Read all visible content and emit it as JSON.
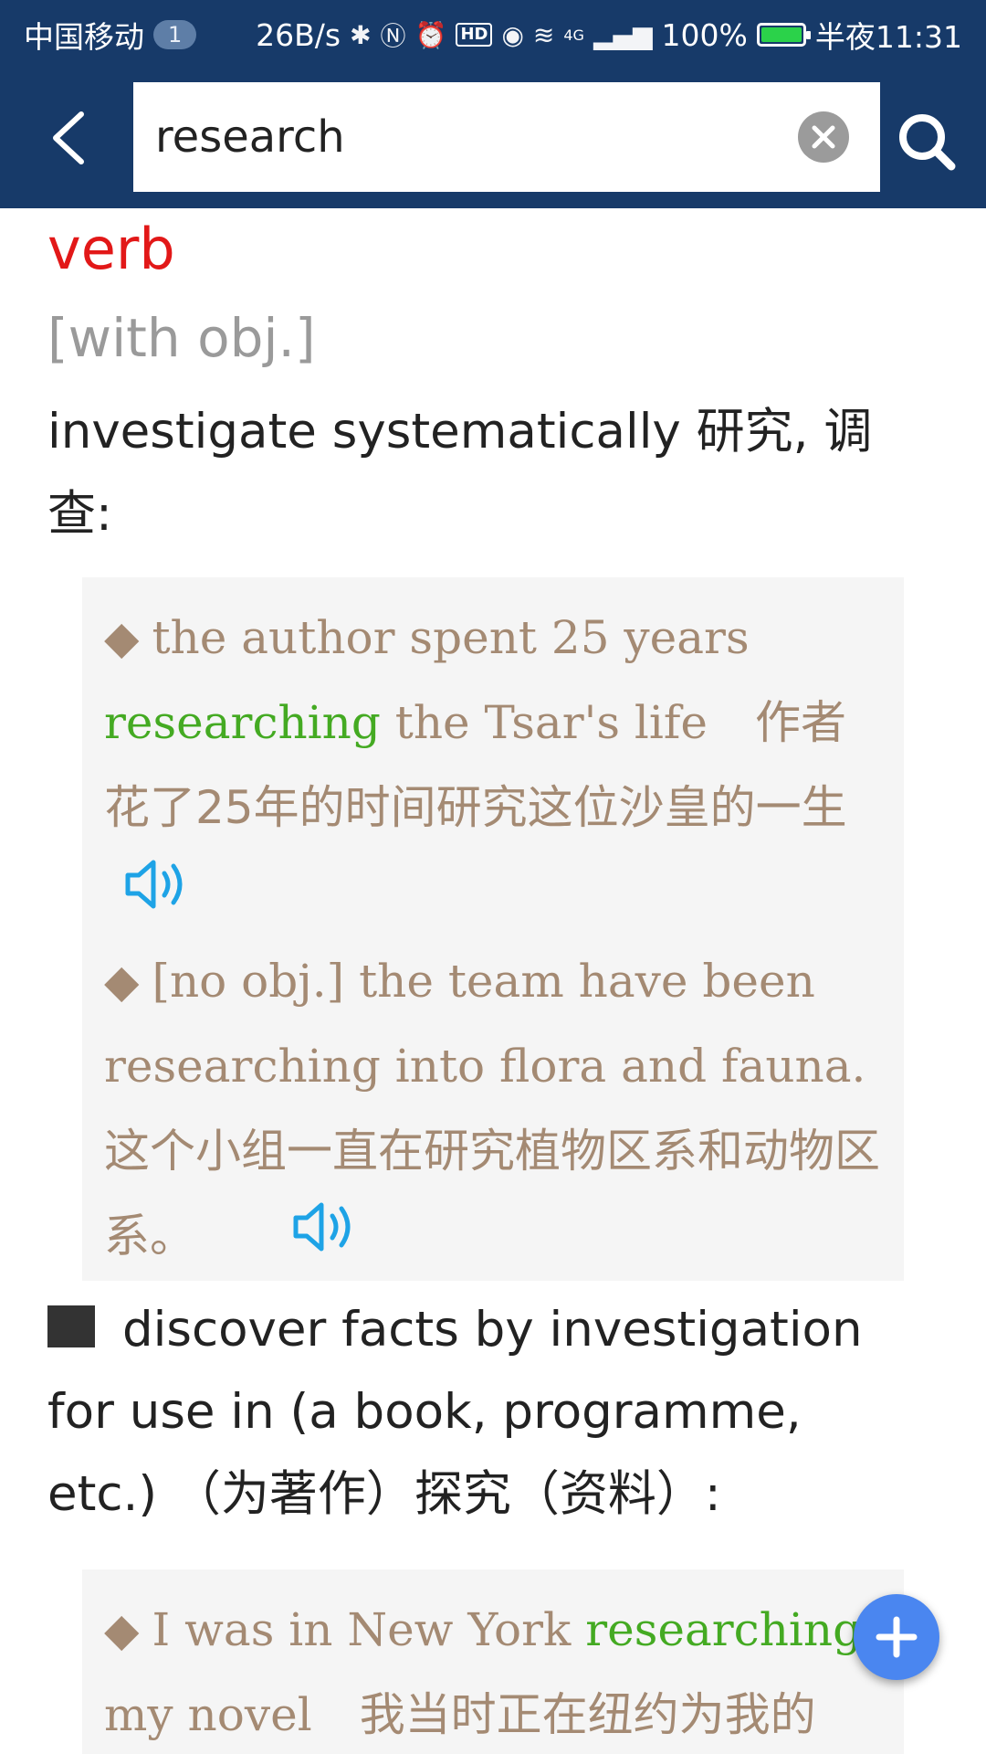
{
  "status_bar": {
    "carrier": "中国移动",
    "sim_badge": "1",
    "net_speed": "26B/s",
    "battery": "100%",
    "time": "半夜11:31",
    "network": "4G"
  },
  "toolbar": {
    "back_icon": "chevron-left-icon",
    "search_value": "research",
    "clear_icon": "clear-circle-icon",
    "search_icon": "search-icon"
  },
  "entry": {
    "part_of_speech": "verb",
    "grammar_note": "[with obj.]",
    "sense1": {
      "definition": "investigate systematically 研究, 调查:",
      "examples": [
        {
          "en_before": "the author spent 25 years ",
          "highlight": "researching",
          "en_after": " the Tsar's life",
          "zh": "作者花了25年的时间研究这位沙皇的一生"
        },
        {
          "en": "[no obj.] the team have been researching into flora and fauna.",
          "zh": "这个小组一直在研究植物区系和动物区系。"
        }
      ]
    },
    "sense2": {
      "definition": "discover facts by investigation for use in (a book, programme, etc.) （为著作）探究（资料）:",
      "examples": [
        {
          "en_before": "I was in New York ",
          "highlight": "researching",
          "en_after": " my novel",
          "zh": "我当时正在纽约为我的"
        }
      ]
    }
  },
  "fab": {
    "icon": "plus-icon"
  },
  "colors": {
    "header_bg": "#173a69",
    "pos_red": "#e21818",
    "example_text": "#a48a73",
    "highlight_green": "#44aa22",
    "speaker_blue": "#1ea3e6",
    "fab_blue": "#4a86f0"
  }
}
